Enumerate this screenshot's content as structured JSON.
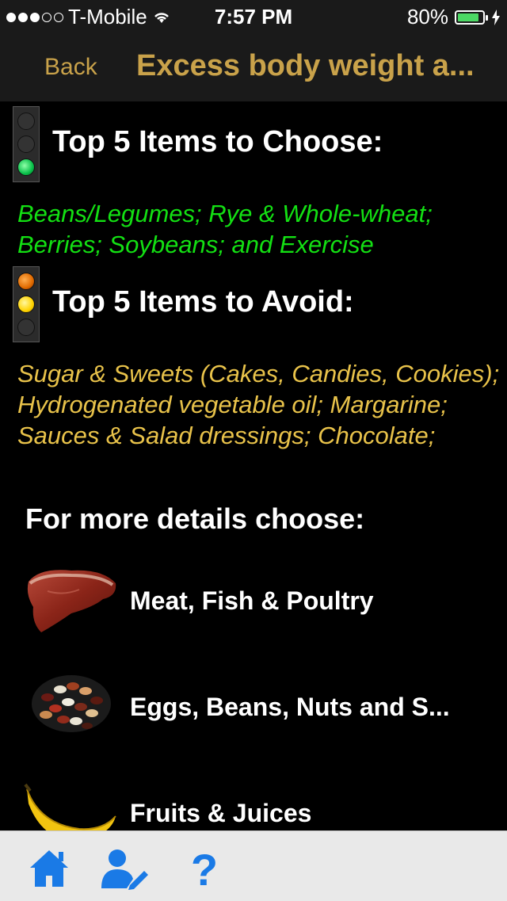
{
  "status": {
    "carrier": "T-Mobile",
    "time": "7:57 PM",
    "battery": "80%",
    "signal_bars": 3,
    "signal_total": 5,
    "battery_level": 0.8
  },
  "nav": {
    "back_label": "Back",
    "title": "Excess body weight a..."
  },
  "choose": {
    "heading": "Top 5 Items to Choose:",
    "text": "Beans/Legumes; Rye & Whole-wheat; Berries; Soybeans;  and Exercise"
  },
  "avoid": {
    "heading": "Top 5 Items to Avoid:",
    "text": "Sugar & Sweets (Cakes, Candies, Cookies); Hydrogenated vegetable oil; Margarine; Sauces & Salad dressings; Chocolate;"
  },
  "details": {
    "heading": "For more details choose:",
    "items": [
      {
        "label": "Meat, Fish & Poultry",
        "icon": "meat-icon"
      },
      {
        "label": "Eggs, Beans, Nuts and S...",
        "icon": "beans-icon"
      },
      {
        "label": "Fruits & Juices",
        "icon": "banana-icon"
      }
    ]
  },
  "tabs": [
    {
      "icon": "home-icon"
    },
    {
      "icon": "user-edit-icon"
    },
    {
      "icon": "help-icon"
    }
  ],
  "colors": {
    "accent_gold": "#c9a24a",
    "choose_green": "#13e013",
    "avoid_yellow": "#e8c24a",
    "tab_blue": "#1a7ae6"
  }
}
